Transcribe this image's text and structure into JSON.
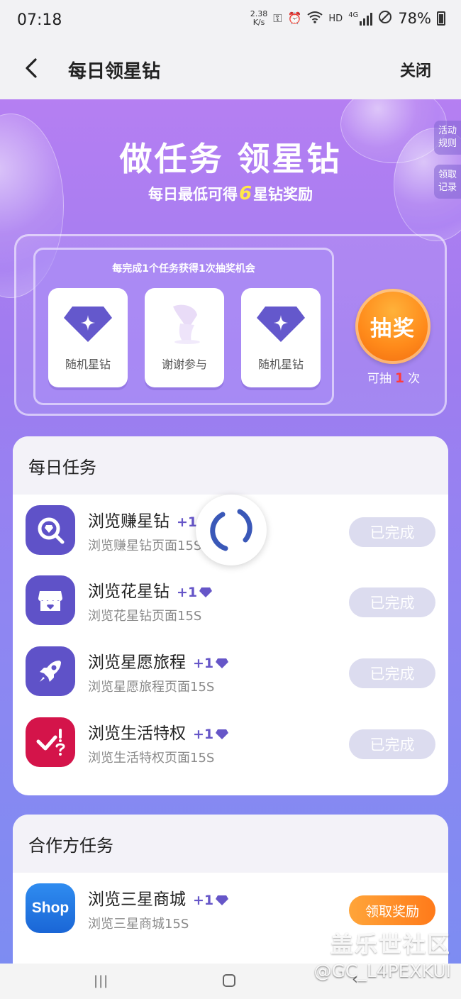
{
  "status_bar": {
    "time": "07:18",
    "speed_value": "2.38",
    "speed_unit": "K/s",
    "hd_label": "HD",
    "network_label": "4G",
    "battery": "78%"
  },
  "app_bar": {
    "title": "每日领星钻",
    "close_label": "关闭"
  },
  "hero": {
    "title": "做任务 领星钻",
    "subtitle_prefix": "每日最低可得",
    "subtitle_number": "6",
    "subtitle_suffix": "星钻奖励",
    "rules_tab": "活动规则",
    "records_tab": "领取记录"
  },
  "lottery": {
    "hint": "每完成1个任务获得1次抽奖机会",
    "prizes": [
      {
        "label": "随机星钻",
        "icon": "gem-icon"
      },
      {
        "label": "谢谢参与",
        "icon": "thanks-icon"
      },
      {
        "label": "随机星钻",
        "icon": "gem-icon"
      }
    ],
    "draw_label": "抽奖",
    "count_prefix": "可抽",
    "count_value": "1",
    "count_suffix": "次"
  },
  "daily_tasks": {
    "heading": "每日任务",
    "items": [
      {
        "title": "浏览赚星钻",
        "plus": "+1",
        "desc": "浏览赚星钻页面15S",
        "status": "已完成",
        "icon": "search-gem-icon"
      },
      {
        "title": "浏览花星钻",
        "plus": "+1",
        "desc": "浏览花星钻页面15S",
        "status": "已完成",
        "icon": "store-icon"
      },
      {
        "title": "浏览星愿旅程",
        "plus": "+1",
        "desc": "浏览星愿旅程页面15S",
        "status": "已完成",
        "icon": "rocket-icon"
      },
      {
        "title": "浏览生活特权",
        "plus": "+1",
        "desc": "浏览生活特权页面15S",
        "status": "已完成",
        "icon": "check-question-icon"
      }
    ]
  },
  "partner_tasks": {
    "heading": "合作方任务",
    "items": [
      {
        "title": "浏览三星商城",
        "plus": "+1",
        "desc": "浏览三星商城15S",
        "status": "领取奖励",
        "icon_text": "Shop"
      }
    ]
  },
  "watermark": {
    "brand": "盖乐世社区",
    "user": "@GC_L4PEXKUI"
  },
  "colors": {
    "accent_purple": "#6656c8",
    "done_button": "#dcdcef",
    "claim_button": "#ff8a1a",
    "lucky_red": "#ff3b3b",
    "highlight_yellow": "#ffe74a"
  }
}
